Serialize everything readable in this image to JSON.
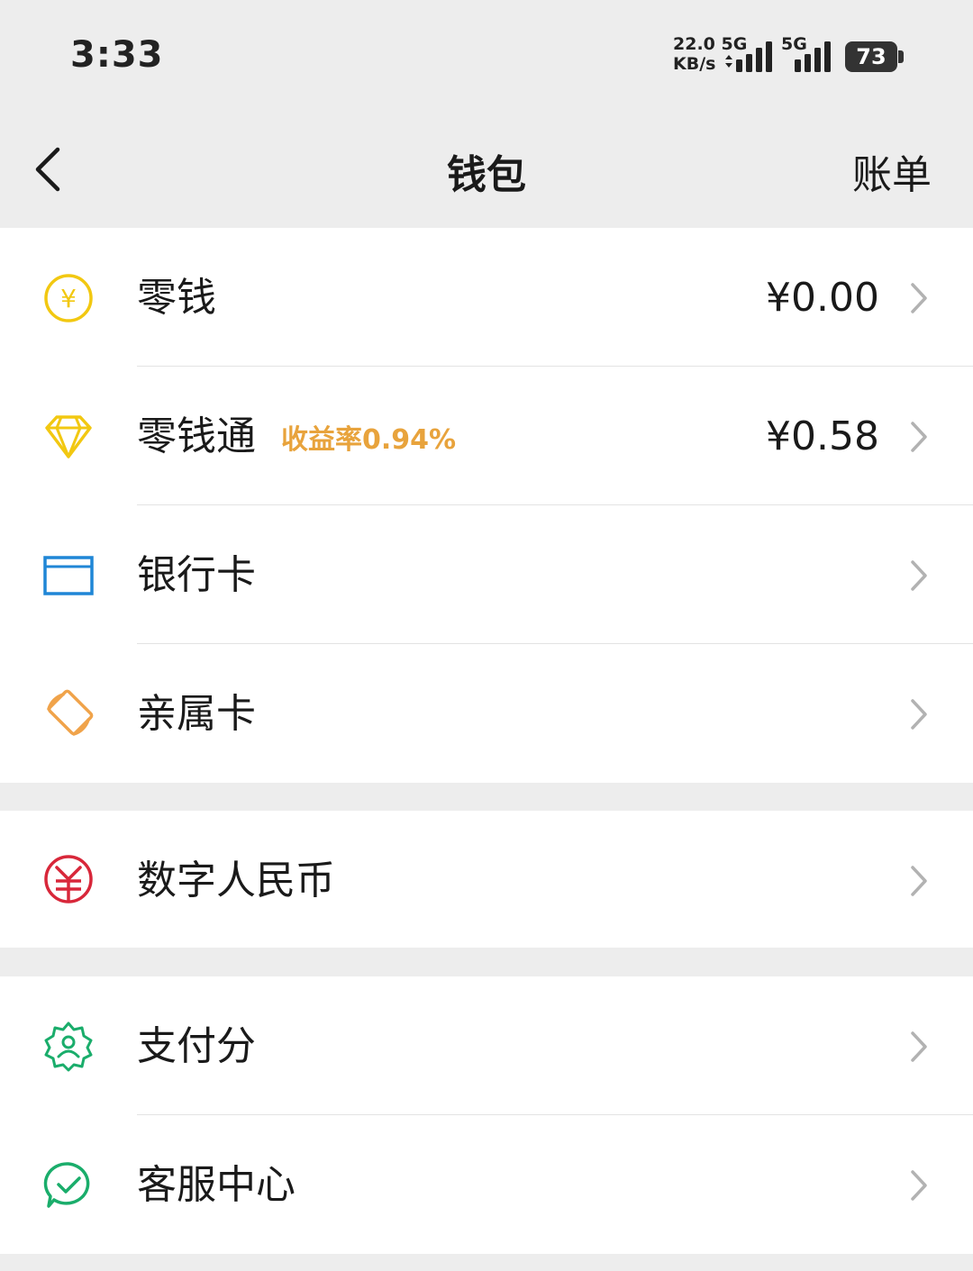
{
  "status_bar": {
    "time": "3:33",
    "network_speed": "22.0",
    "network_unit": "KB/s",
    "net_type_1": "5G",
    "net_type_2": "5G",
    "battery": "73"
  },
  "nav": {
    "title": "钱包",
    "right_label": "账单"
  },
  "group1": [
    {
      "label": "零钱",
      "value": "¥0.00",
      "icon": "yuan-coin-icon",
      "color": "#f2c811"
    },
    {
      "label": "零钱通",
      "tag": "收益率0.94%",
      "value": "¥0.58",
      "icon": "diamond-icon",
      "color": "#f2c811"
    },
    {
      "label": "银行卡",
      "icon": "bank-card-icon",
      "color": "#1f86d6"
    },
    {
      "label": "亲属卡",
      "icon": "family-card-icon",
      "color": "#f0a34a"
    }
  ],
  "group2": [
    {
      "label": "数字人民币",
      "icon": "digital-rmb-icon",
      "color": "#d8273a"
    }
  ],
  "group3": [
    {
      "label": "支付分",
      "icon": "pay-score-icon",
      "color": "#1aad6b"
    },
    {
      "label": "客服中心",
      "icon": "customer-service-icon",
      "color": "#1aad6b"
    }
  ]
}
